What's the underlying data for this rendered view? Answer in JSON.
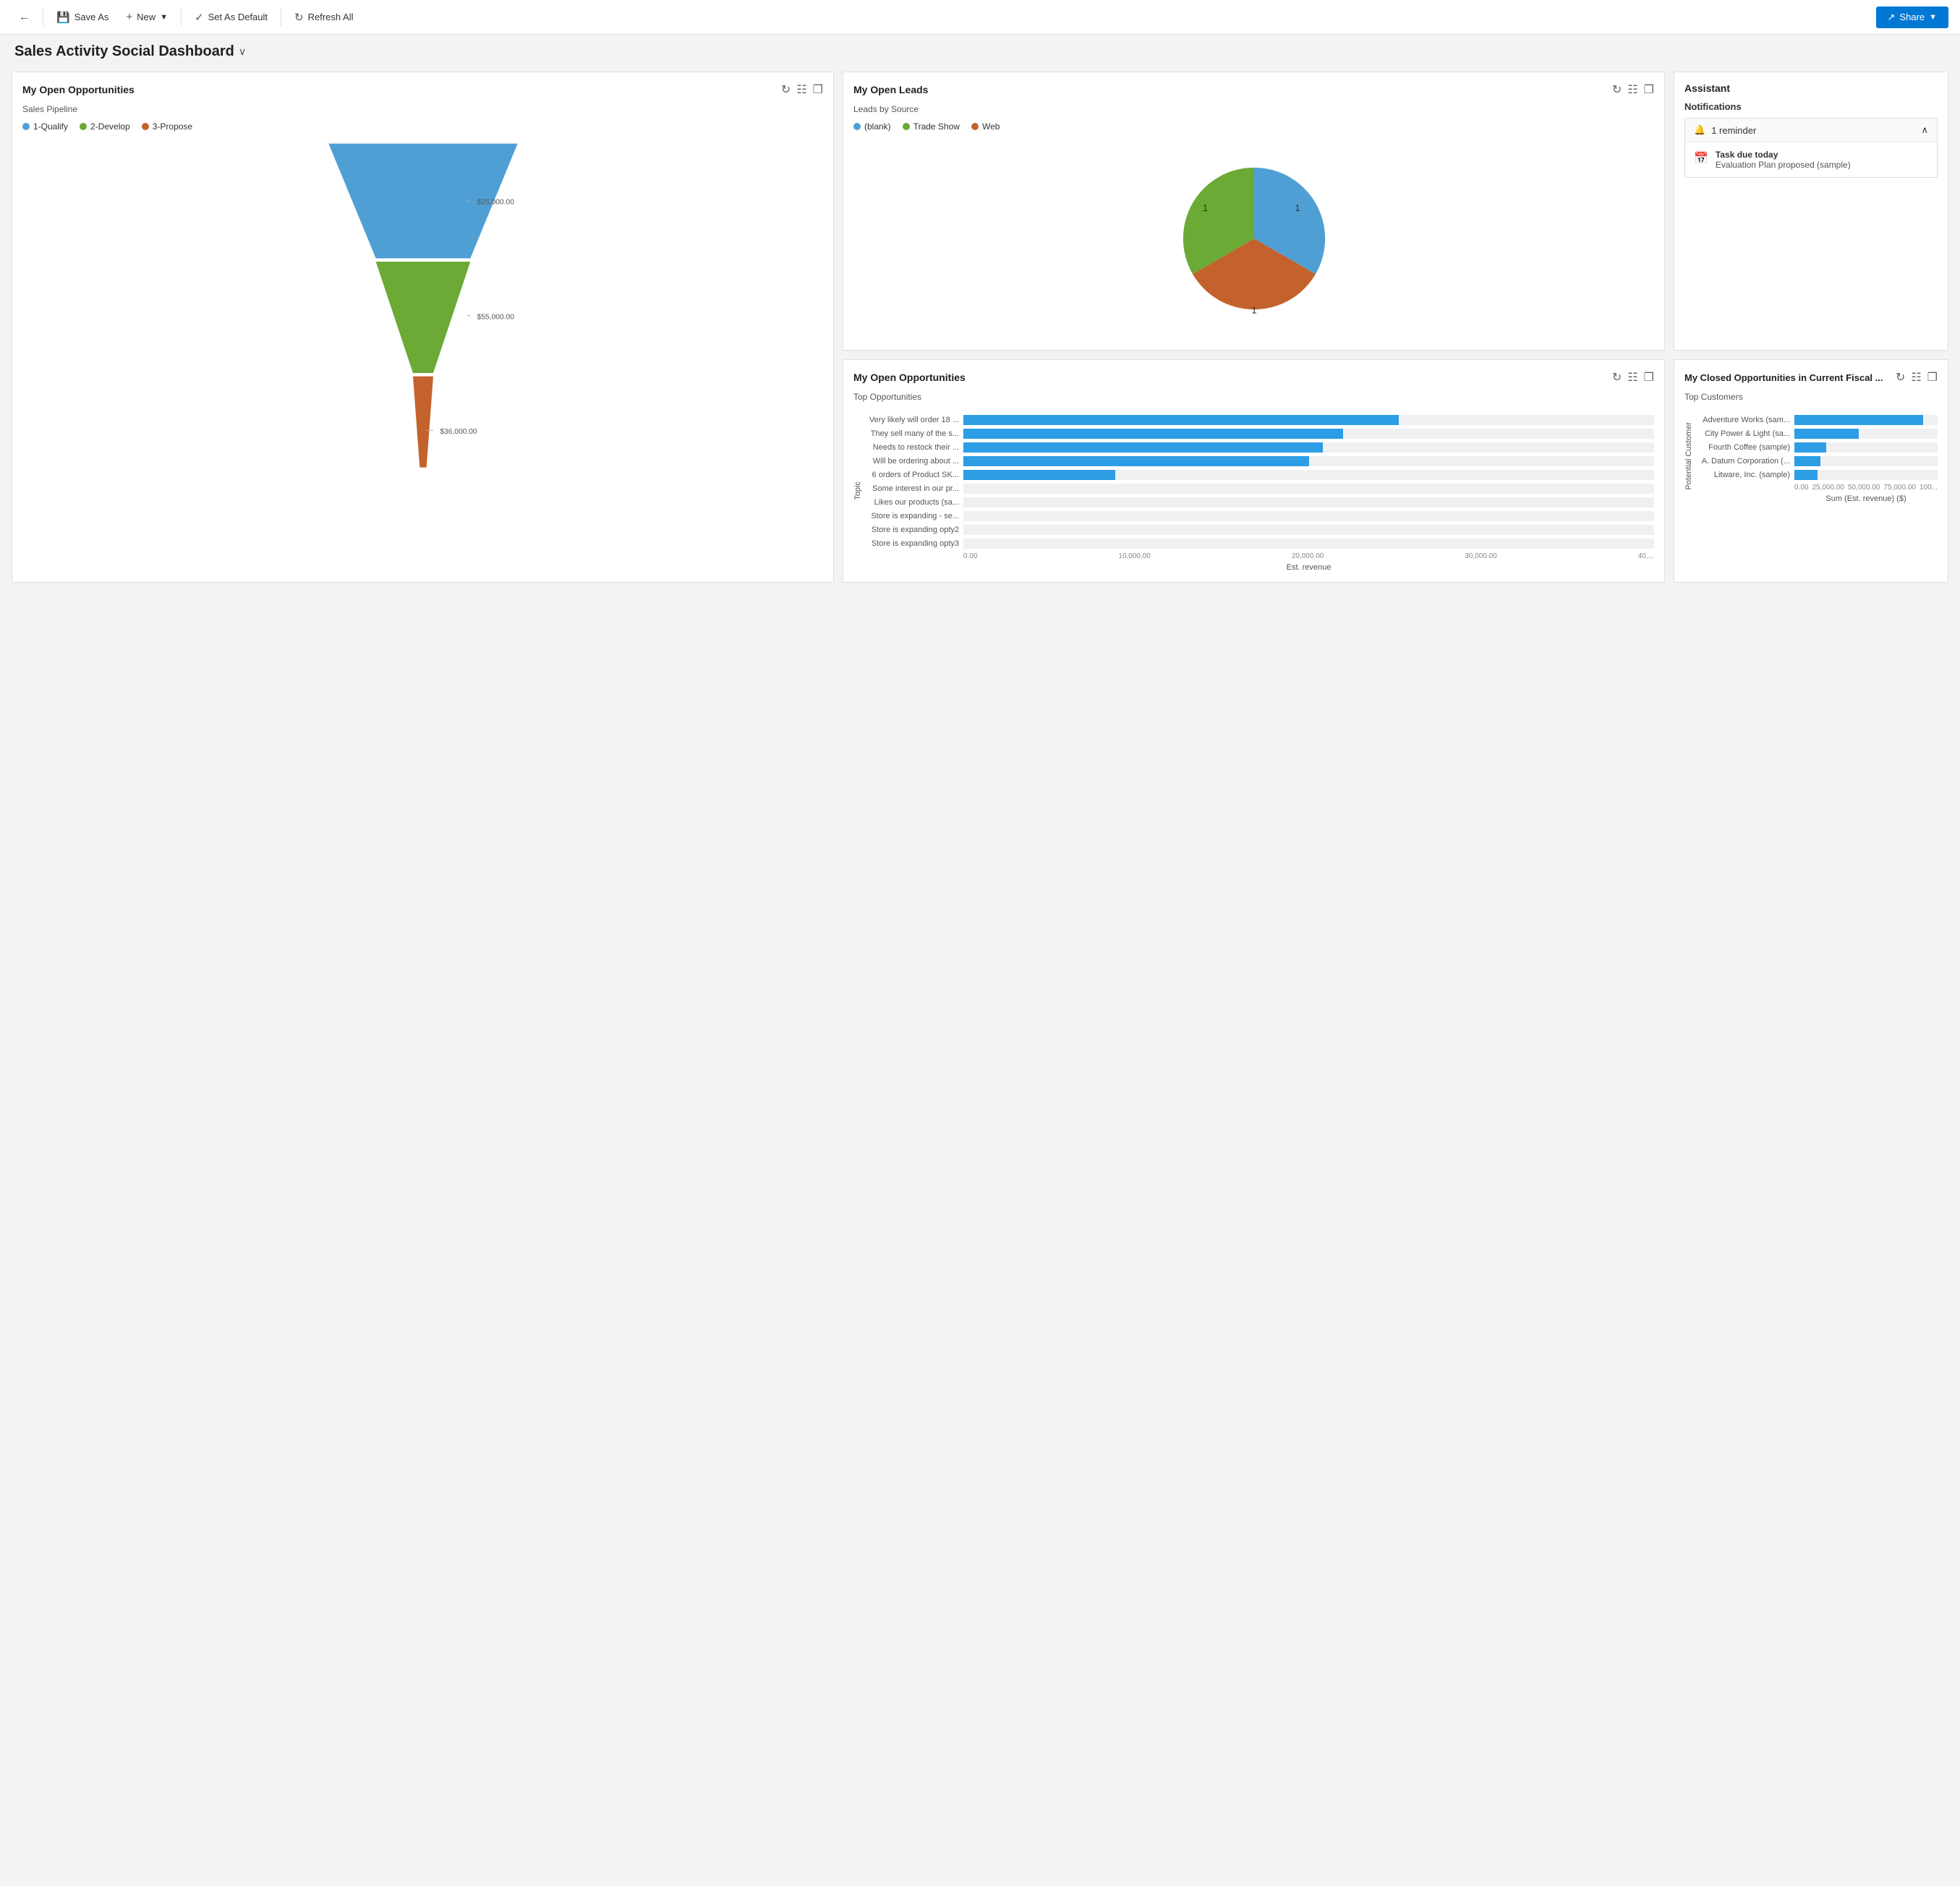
{
  "toolbar": {
    "back_icon": "←",
    "save_as_icon": "💾",
    "save_as_label": "Save As",
    "new_icon": "+",
    "new_label": "New",
    "new_chevron": "▾",
    "set_default_icon": "✓",
    "set_default_label": "Set As Default",
    "refresh_icon": "↻",
    "refresh_label": "Refresh All",
    "share_icon": "↗",
    "share_label": "Share",
    "share_chevron": "▾"
  },
  "page": {
    "title": "Sales Activity Social Dashboard",
    "chevron": "∨"
  },
  "open_opps": {
    "title": "My Open Opportunities",
    "subtitle": "Sales Pipeline",
    "legend": [
      {
        "label": "1-Qualify",
        "color": "#4f9fd4"
      },
      {
        "label": "2-Develop",
        "color": "#6aaa35"
      },
      {
        "label": "3-Propose",
        "color": "#c4622d"
      }
    ],
    "funnel": [
      {
        "label": "1-Qualify",
        "value": "$25,000.00",
        "color": "#4f9fd4",
        "width": 1.0
      },
      {
        "label": "2-Develop",
        "value": "$55,000.00",
        "color": "#6aaa35",
        "width": 0.72
      },
      {
        "label": "3-Propose",
        "value": "$36,000.00",
        "color": "#c4622d",
        "width": 0.38
      }
    ]
  },
  "open_leads": {
    "title": "My Open Leads",
    "subtitle": "Leads by Source",
    "legend": [
      {
        "label": "(blank)",
        "color": "#4f9fd4"
      },
      {
        "label": "Trade Show",
        "color": "#6aaa35"
      },
      {
        "label": "Web",
        "color": "#c4622d"
      }
    ],
    "pie_slices": [
      {
        "label": "(blank)",
        "value": 1,
        "color": "#4f9fd4",
        "startAngle": 0,
        "endAngle": 120
      },
      {
        "label": "Trade Show",
        "value": 1,
        "color": "#6aaa35",
        "startAngle": 120,
        "endAngle": 240
      },
      {
        "label": "Web",
        "value": 1,
        "color": "#c4622d",
        "startAngle": 240,
        "endAngle": 360
      }
    ],
    "labels": [
      {
        "text": "1",
        "angle": 60
      },
      {
        "text": "1",
        "angle": 180
      },
      {
        "text": "1",
        "angle": 300
      }
    ]
  },
  "assistant": {
    "title": "Assistant",
    "notifications_title": "Notifications",
    "reminder_label": "1 reminder",
    "reminder_chevron": "∧",
    "task": {
      "line1": "Task due today",
      "line2": "Evaluation Plan proposed (sample)"
    }
  },
  "top_opps": {
    "title": "My Open Opportunities",
    "subtitle": "Top Opportunities",
    "y_label": "Topic",
    "x_label": "Est. revenue",
    "bars": [
      {
        "label": "Very likely will order 18 ...",
        "value": 63,
        "display": ""
      },
      {
        "label": "They sell many of the s...",
        "value": 55,
        "display": ""
      },
      {
        "label": "Needs to restock their ...",
        "value": 52,
        "display": ""
      },
      {
        "label": "Will be ordering about ...",
        "value": 50,
        "display": ""
      },
      {
        "label": "6 orders of Product SK...",
        "value": 22,
        "display": ""
      },
      {
        "label": "Some interest in our pr...",
        "value": 0,
        "display": ""
      },
      {
        "label": "Likes our products (sa...",
        "value": 0,
        "display": ""
      },
      {
        "label": "Store is expanding - se...",
        "value": 0,
        "display": ""
      },
      {
        "label": "Store is expanding opty2",
        "value": 0,
        "display": ""
      },
      {
        "label": "Store is expanding opty3",
        "value": 0,
        "display": ""
      }
    ],
    "x_axis": [
      "0.00",
      "10,000.00",
      "20,000.00",
      "30,000.00",
      "40,..."
    ]
  },
  "closed_opps": {
    "title": "My Closed Opportunities in Current Fiscal ...",
    "subtitle": "Top Customers",
    "y_label": "Potential Customer",
    "x_label": "Sum (Est. revenue) ($)",
    "bars": [
      {
        "label": "Adventure Works (sam...",
        "value": 90,
        "display": ""
      },
      {
        "label": "City Power & Light (sa...",
        "value": 45,
        "display": ""
      },
      {
        "label": "Fourth Coffee (sample)",
        "value": 22,
        "display": ""
      },
      {
        "label": "A. Datum Corporation (...",
        "value": 18,
        "display": ""
      },
      {
        "label": "Litware, Inc. (sample)",
        "value": 16,
        "display": ""
      }
    ],
    "x_axis": [
      "0.00",
      "25,000.00",
      "50,000.00",
      "75,000.00",
      "100..."
    ]
  }
}
